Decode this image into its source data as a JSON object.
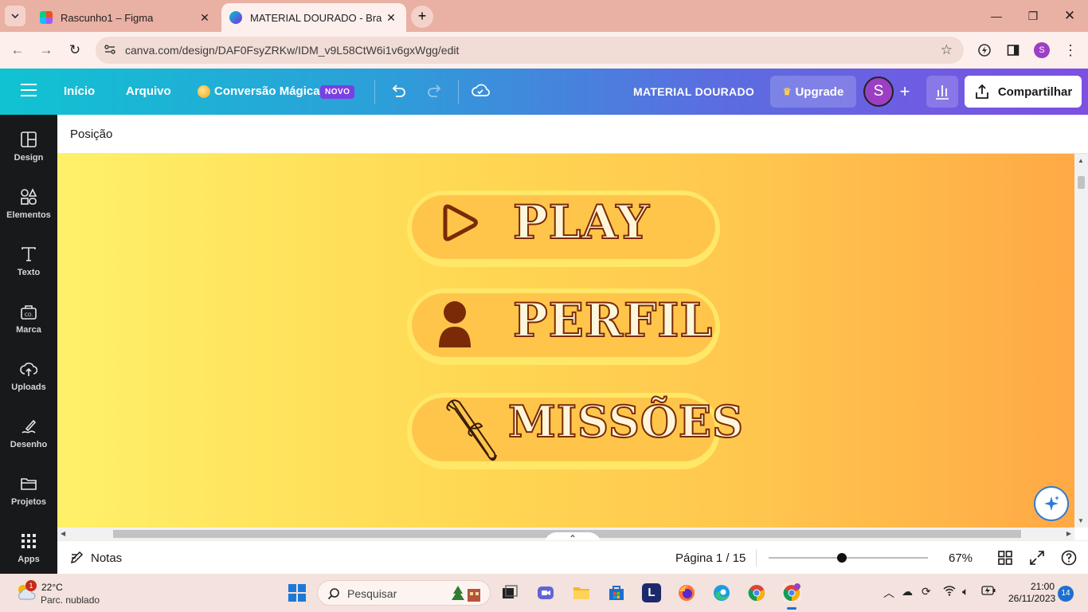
{
  "browser": {
    "tabs": [
      {
        "title": "Rascunho1 – Figma"
      },
      {
        "title": "MATERIAL DOURADO - Brainst",
        "active": true
      }
    ],
    "url": "canva.com/design/DAF0FsyZRKw/IDM_v9L58CtW6i1v6gxWgg/edit",
    "profile_initial": "S"
  },
  "header": {
    "menu": [
      "Início",
      "Arquivo"
    ],
    "magic_label": "Conversão Mágica",
    "novo_badge": "NOVO",
    "doc_title": "MATERIAL DOURADO",
    "upgrade_label": "Upgrade",
    "avatar_initial": "S",
    "share_label": "Compartilhar"
  },
  "sidebar": {
    "items": [
      {
        "label": "Design",
        "icon": "design-icon"
      },
      {
        "label": "Elementos",
        "icon": "elements-icon"
      },
      {
        "label": "Texto",
        "icon": "text-icon"
      },
      {
        "label": "Marca",
        "icon": "brand-icon"
      },
      {
        "label": "Uploads",
        "icon": "upload-icon"
      },
      {
        "label": "Desenho",
        "icon": "draw-icon"
      },
      {
        "label": "Projetos",
        "icon": "folder-icon"
      },
      {
        "label": "Apps",
        "icon": "apps-icon"
      }
    ]
  },
  "toolbar": {
    "position_label": "Posição"
  },
  "canvas": {
    "buttons": [
      {
        "label": "PLAY",
        "icon": "play-icon"
      },
      {
        "label": "PERFIL",
        "icon": "person-icon"
      },
      {
        "label": "MISSÕES",
        "icon": "scroll-icon"
      }
    ],
    "colors": {
      "bg_start": "#fff06a",
      "bg_end": "#ffa945",
      "pill_outer": "#ffe768",
      "pill_inner": "#ffc54b",
      "text_stroke": "#7a2a07",
      "icon_brown": "#7a2a07"
    }
  },
  "footer": {
    "notes_label": "Notas",
    "page_indicator": "Página 1 / 15",
    "zoom": "67%",
    "zoom_fraction": 0.46
  },
  "taskbar": {
    "weather_temp": "22°C",
    "weather_desc": "Parc. nublado",
    "weather_badge": "1",
    "search_label": "Pesquisar",
    "time": "21:00",
    "date": "26/11/2023",
    "notifications": "14"
  }
}
